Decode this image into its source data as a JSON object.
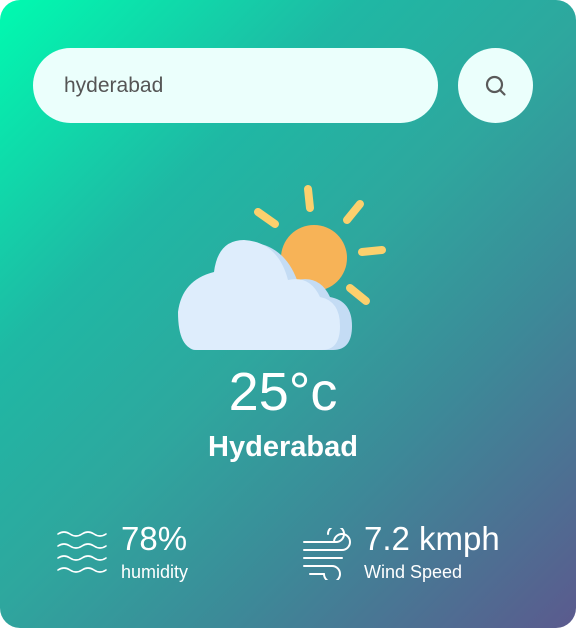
{
  "search": {
    "value": "hyderabad",
    "placeholder": ""
  },
  "weather": {
    "icon": "sun-behind-cloud-icon",
    "temperature": "25°c",
    "city": "Hyderabad"
  },
  "details": {
    "humidity": {
      "value": "78%",
      "label": "humidity",
      "icon": "waves-icon"
    },
    "wind": {
      "value": "7.2 kmph",
      "label": "Wind Speed",
      "icon": "wind-icon"
    }
  },
  "colors": {
    "gradient_start": "#00fbb0",
    "gradient_end": "#5b5a8e",
    "input_bg": "#ebfffc",
    "sun": "#f7b357",
    "sun_rays": "#fcd06d",
    "cloud": "#deedfc"
  }
}
